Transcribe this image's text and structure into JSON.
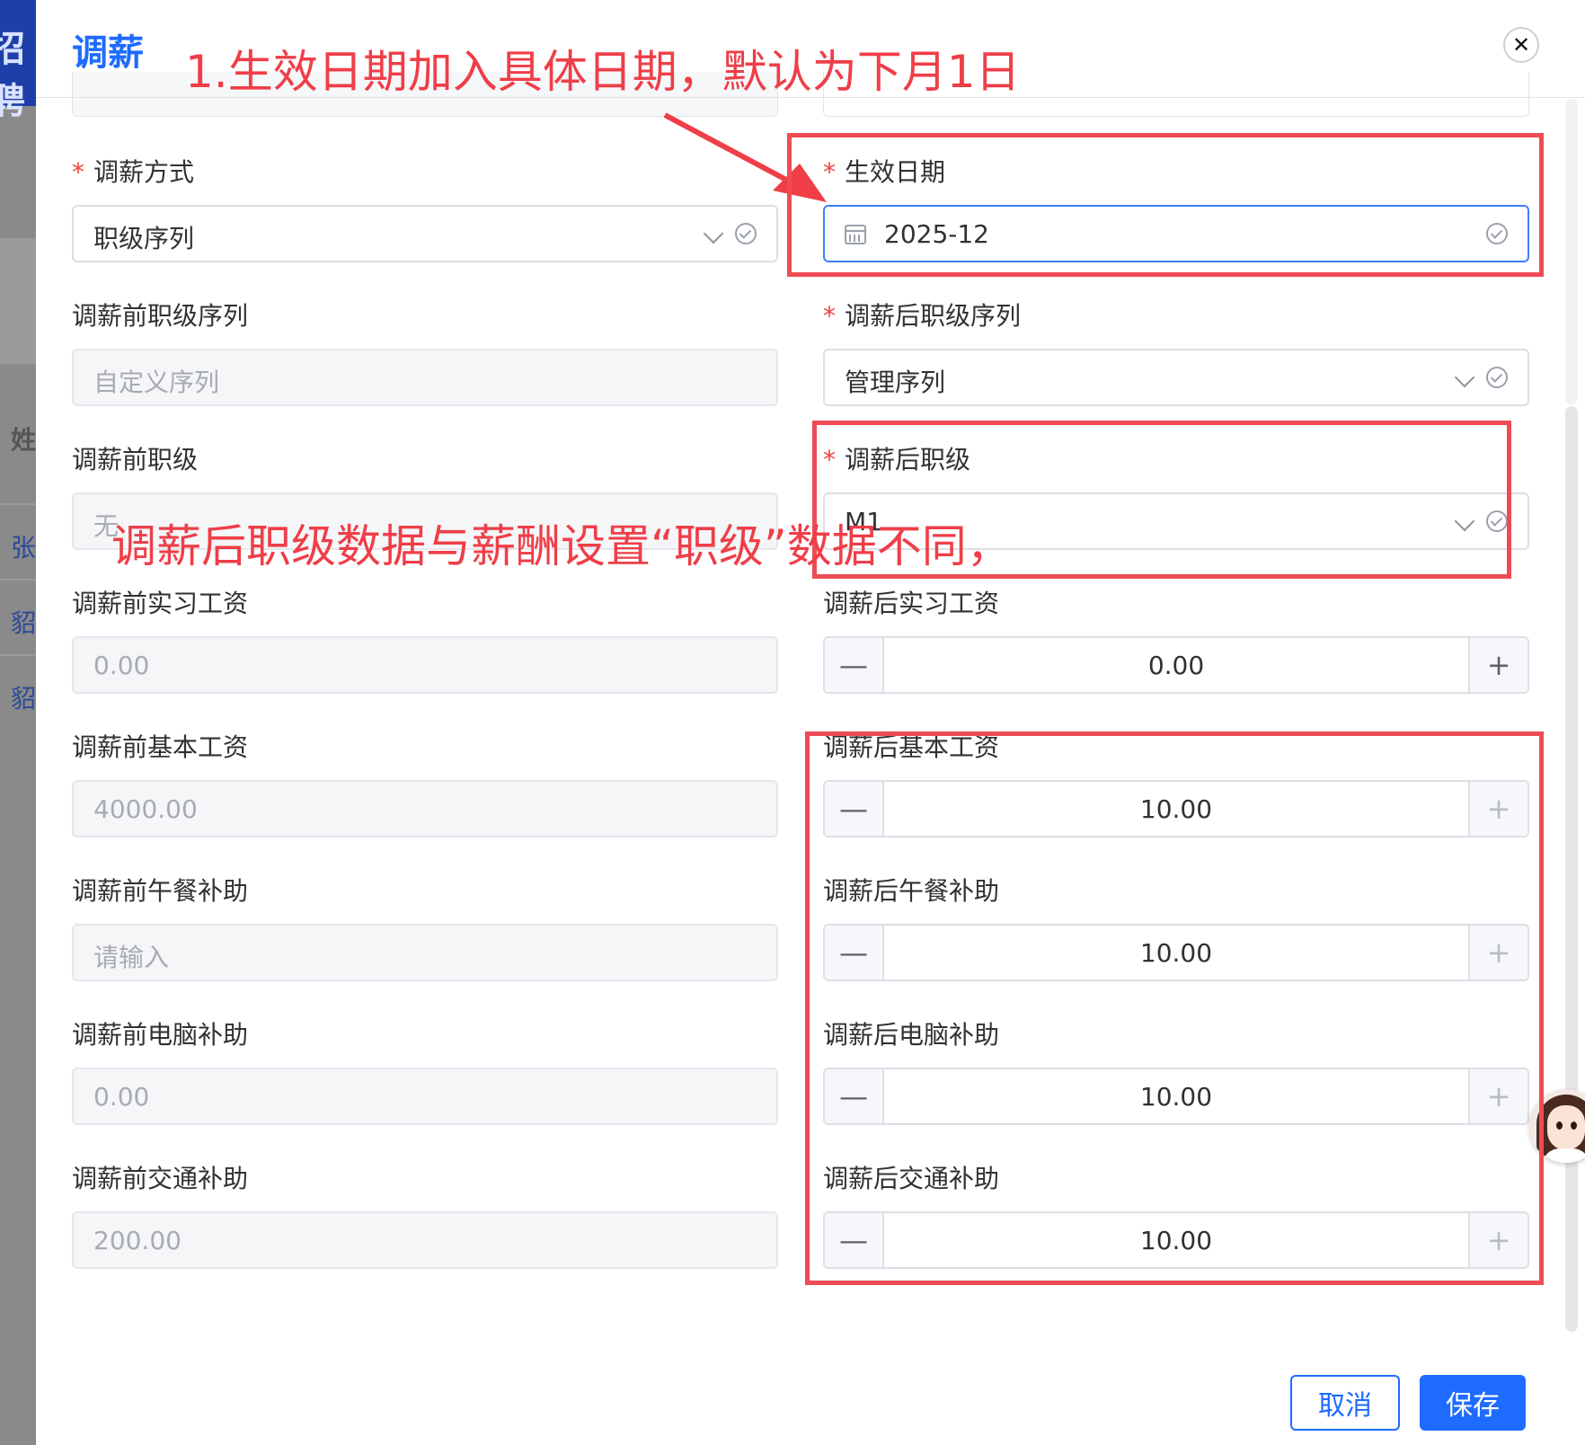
{
  "background": {
    "header_text": "招聘",
    "name_header": "姓",
    "rows": [
      "张",
      "貂",
      "貂"
    ]
  },
  "modal": {
    "title": "调薪",
    "close_icon": "close-icon"
  },
  "form": {
    "method": {
      "label": "调薪方式",
      "required": "*",
      "value": "职级序列"
    },
    "effective_date": {
      "label": "生效日期",
      "required": "*",
      "value": "2025-12"
    },
    "prev_sequence": {
      "label": "调薪前职级序列",
      "value": "自定义序列"
    },
    "new_sequence": {
      "label": "调薪后职级序列",
      "required": "*",
      "value": "管理序列"
    },
    "prev_level": {
      "label": "调薪前职级",
      "value": "无"
    },
    "new_level": {
      "label": "调薪后职级",
      "required": "*",
      "value": "M1"
    },
    "prev_intern": {
      "label": "调薪前实习工资",
      "value": "0.00"
    },
    "new_intern": {
      "label": "调薪后实习工资",
      "value": "0.00"
    },
    "prev_base": {
      "label": "调薪前基本工资",
      "value": "4000.00"
    },
    "new_base": {
      "label": "调薪后基本工资",
      "value": "10.00"
    },
    "prev_lunch": {
      "label": "调薪前午餐补助",
      "placeholder": "请输入"
    },
    "new_lunch": {
      "label": "调薪后午餐补助",
      "value": "10.00"
    },
    "prev_computer": {
      "label": "调薪前电脑补助",
      "value": "0.00"
    },
    "new_computer": {
      "label": "调薪后电脑补助",
      "value": "10.00"
    },
    "prev_transport": {
      "label": "调薪前交通补助",
      "value": "200.00"
    },
    "new_transport": {
      "label": "调薪后交通补助",
      "value": "10.00"
    }
  },
  "stepper": {
    "minus": "—",
    "plus": "+"
  },
  "annotations": {
    "top_note": "1.生效日期加入具体日期，默认为下月1日",
    "level_note": "调薪后职级数据与薪酬设置“职级”数据不同，"
  },
  "footer": {
    "cancel": "取消",
    "save": "保存"
  },
  "colors": {
    "primary": "#1e6bff",
    "annotation": "#ef4b55",
    "required": "#f0413c"
  }
}
